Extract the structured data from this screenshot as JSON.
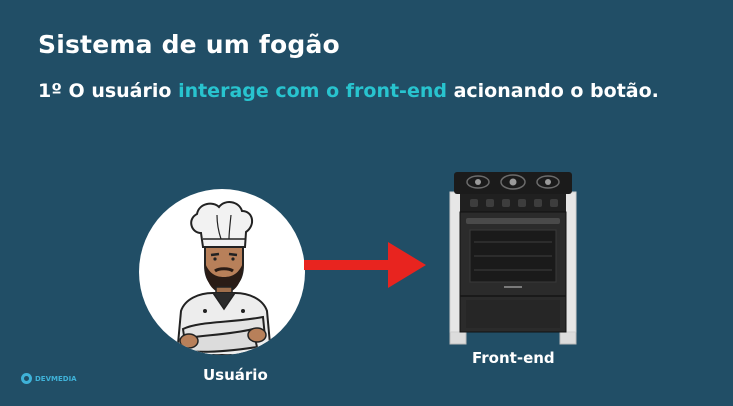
{
  "slide": {
    "title": "Sistema de um fogão",
    "step": {
      "prefix": "1º O usuário ",
      "highlight": "interage com o front-end",
      "suffix": " acionando o botão."
    },
    "highlight_color": "#28c4cf",
    "background_color": "#214e66"
  },
  "diagram": {
    "user_label": "Usuário",
    "frontend_label": "Front-end",
    "user_icon": "chef-illustration",
    "frontend_icon": "stove-image",
    "arrow_icon": "right-arrow-icon",
    "arrow_color": "#e8241f"
  },
  "brand": {
    "name": "DEVMEDIA"
  }
}
